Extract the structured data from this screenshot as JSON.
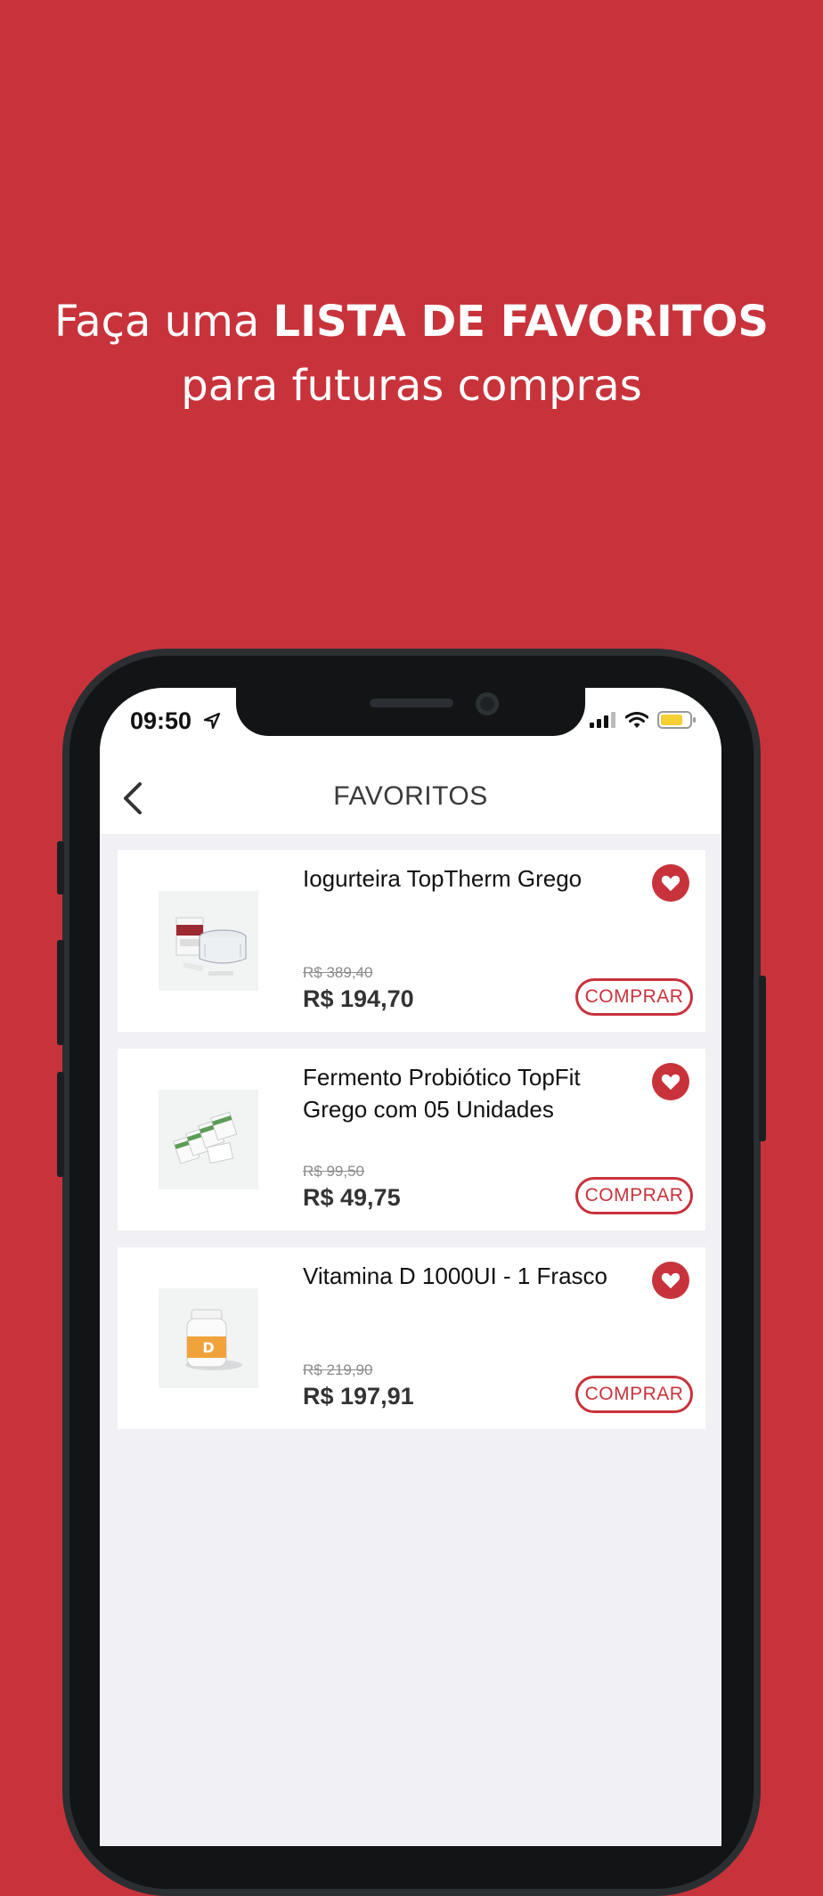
{
  "headline": {
    "line1_prefix": "Faça uma",
    "line1_bold": "LISTA DE FAVORITOS",
    "line2": "para futuras compras"
  },
  "statusbar": {
    "time": "09:50"
  },
  "navbar": {
    "title": "FAVORITOS"
  },
  "favorites": [
    {
      "name": "Iogurteira TopTherm Grego",
      "old_price": "R$ 389,40",
      "price": "R$ 194,70",
      "buy_label": "COMPRAR",
      "image": "yogurt-maker-product-image"
    },
    {
      "name": "Fermento Probiótico TopFit Grego com 05 Unidades",
      "old_price": "R$ 99,50",
      "price": "R$ 49,75",
      "buy_label": "COMPRAR",
      "image": "probiotic-sachets-product-image"
    },
    {
      "name": "Vitamina D 1000UI - 1 Frasco",
      "old_price": "R$ 219,90",
      "price": "R$ 197,91",
      "buy_label": "COMPRAR",
      "image": "vitamin-d-bottle-product-image"
    }
  ],
  "colors": {
    "brand": "#c8333b",
    "screen_bg": "#f1f1f5",
    "phone_frame": "#121416"
  }
}
